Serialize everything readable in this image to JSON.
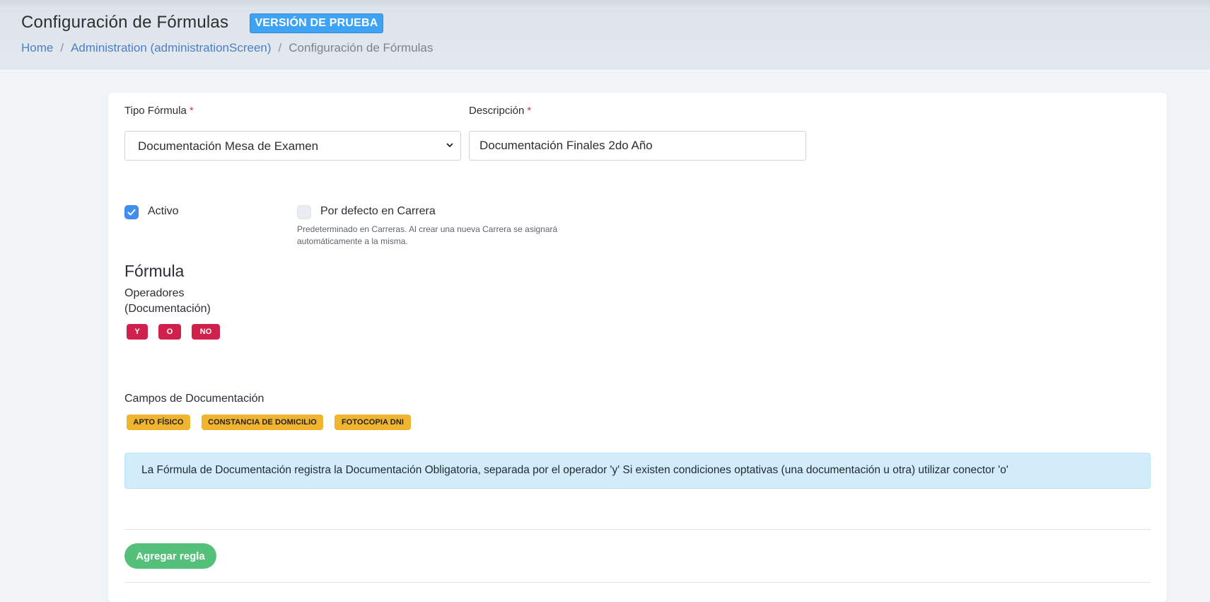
{
  "header": {
    "title": "Configuración de Fórmulas",
    "badge": "VERSIÓN DE PRUEBA",
    "breadcrumb": {
      "home": "Home",
      "admin": "Administration (administrationScreen)",
      "separator": "/",
      "current": "Configuración de Fórmulas"
    }
  },
  "form": {
    "tipo_formula": {
      "label": "Tipo Fórmula",
      "required_mark": "*",
      "selected": "Documentación Mesa de Examen"
    },
    "descripcion": {
      "label": "Descripción",
      "required_mark": "*",
      "value": "Documentación Finales 2do Año"
    },
    "activo": {
      "label": "Activo",
      "checked": true
    },
    "por_defecto": {
      "label": "Por defecto en Carrera",
      "checked": false,
      "help": "Predeterminado en Carreras. Al crear una nueva Carrera se asignará automáticamente a la misma."
    }
  },
  "formula": {
    "title": "Fórmula",
    "operators_label": "Operadores (Documentación)",
    "operators": [
      "Y",
      "O",
      "NO"
    ],
    "fields_label": "Campos de Documentación",
    "fields": [
      "APTO FÍSICO",
      "CONSTANCIA DE DOMICILIO",
      "FOTOCOPIA DNI"
    ],
    "info": "La Fórmula de Documentación registra la Documentación Obligatoria, separada por el operador 'y' Si existen condiciones optativas (una documentación u otra) utilizar conector 'o'"
  },
  "actions": {
    "add_rule": "Agregar regla"
  },
  "colors": {
    "accent": "#3ea3f5",
    "operator": "#d0214d",
    "field": "#f0b52f",
    "success": "#55c07a",
    "info_bg": "#d3ecfa"
  }
}
